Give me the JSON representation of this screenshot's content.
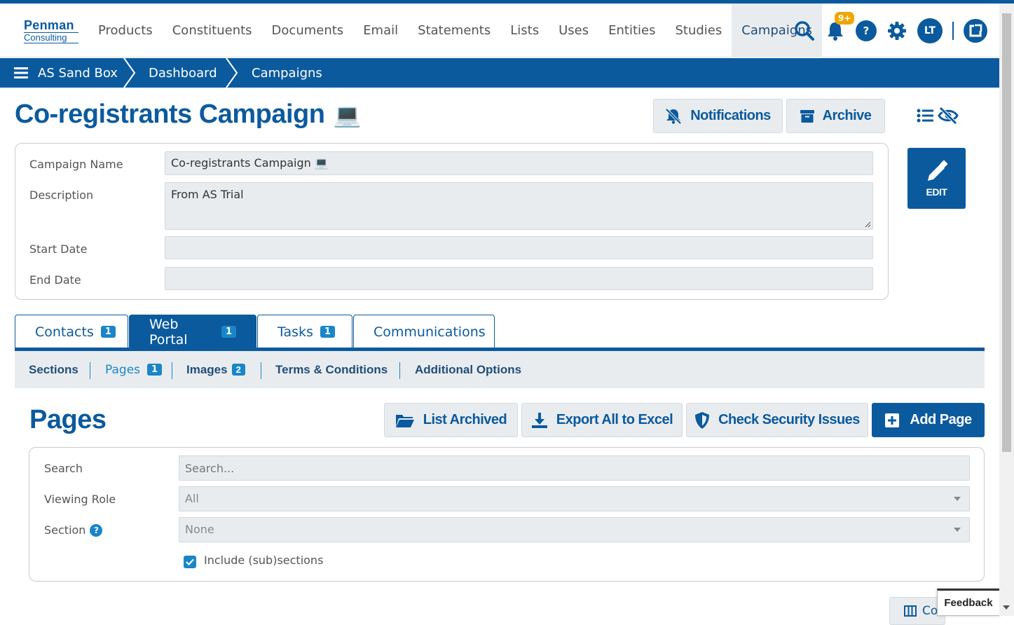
{
  "brand": {
    "logo_line1": "Penman",
    "logo_line2": "Consulting"
  },
  "nav": {
    "links": [
      "Products",
      "Constituents",
      "Documents",
      "Email",
      "Statements",
      "Lists",
      "Uses",
      "Entities",
      "Studies",
      "Campaigns"
    ],
    "active": "Campaigns",
    "notification_badge": "9+",
    "help_label": "?",
    "user_initials": "LT"
  },
  "breadcrumb": {
    "items": [
      "AS Sand Box",
      "Dashboard",
      "Campaigns"
    ]
  },
  "page": {
    "title": "Co-registrants Campaign",
    "title_emoji": "💻",
    "notifications_label": "Notifications",
    "archive_label": "Archive",
    "edit_label": "EDIT"
  },
  "campaign_form": {
    "name_label": "Campaign Name",
    "name_value": "Co-registrants Campaign 💻",
    "description_label": "Description",
    "description_value": "From AS Trial",
    "start_date_label": "Start Date",
    "start_date_value": "",
    "end_date_label": "End Date",
    "end_date_value": ""
  },
  "tabs": [
    {
      "label": "Contacts",
      "count": "1"
    },
    {
      "label": "Web Portal",
      "count": "1"
    },
    {
      "label": "Tasks",
      "count": "1"
    },
    {
      "label": "Communications",
      "count": ""
    }
  ],
  "subtabs": [
    {
      "label": "Sections",
      "count": ""
    },
    {
      "label": "Pages",
      "count": "1"
    },
    {
      "label": "Images",
      "count": "2"
    },
    {
      "label": "Terms & Conditions",
      "count": ""
    },
    {
      "label": "Additional Options",
      "count": ""
    }
  ],
  "pages_section": {
    "heading": "Pages",
    "list_archived_label": "List Archived",
    "export_label": "Export All to Excel",
    "security_label": "Check Security Issues",
    "add_label": "Add Page"
  },
  "filters": {
    "search_label": "Search",
    "search_placeholder": "Search...",
    "role_label": "Viewing Role",
    "role_value": "All",
    "section_label": "Section",
    "section_value": "None",
    "include_label": "Include (sub)sections",
    "include_checked": true
  },
  "footer": {
    "feedback_label": "Feedback",
    "columns_label": "Co"
  },
  "colors": {
    "primary": "#0b5a9e",
    "accent": "#1a86c8",
    "badge": "#f0a500"
  }
}
